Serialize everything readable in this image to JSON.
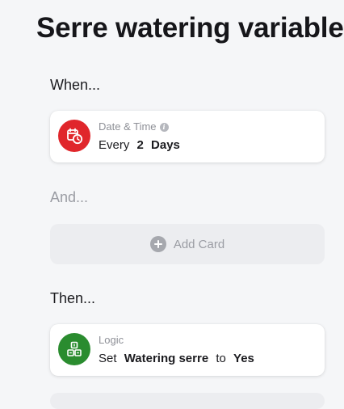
{
  "page": {
    "title": "Serre watering variable"
  },
  "sections": {
    "when": {
      "heading": "When...",
      "card": {
        "title": "Date & Time",
        "icon": "calendar-clock-icon",
        "icon_color": "#e0262b",
        "tokens": [
          "Every",
          "2",
          "Days"
        ]
      }
    },
    "and": {
      "heading": "And...",
      "add_card_label": "Add Card",
      "add_icon": "plus-circle-icon"
    },
    "then": {
      "heading": "Then...",
      "card": {
        "title": "Logic",
        "icon": "logic-blocks-icon",
        "icon_color": "#2a8c2f",
        "tokens": [
          "Set",
          "Watering serre",
          "to",
          "Yes"
        ]
      }
    }
  },
  "colors": {
    "background": "#f5f6f8",
    "card": "#ffffff",
    "muted_text": "#9a9ca3",
    "date_time_red": "#e0262b",
    "logic_green": "#2a8c2f"
  }
}
